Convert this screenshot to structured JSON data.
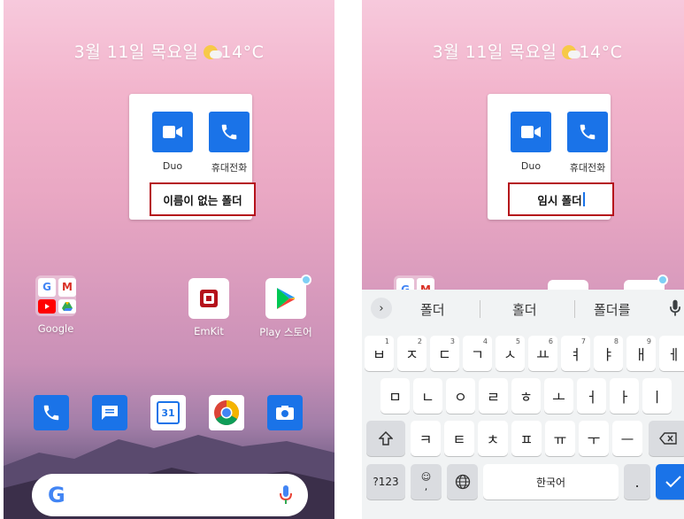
{
  "left": {
    "date_weather": "3월 11일 목요일",
    "temperature": "14°C",
    "folder": {
      "apps": [
        {
          "label": "Duo",
          "icon": "video-camera-icon"
        },
        {
          "label": "휴대전화",
          "icon": "phone-icon"
        }
      ],
      "name": "이름이 없는 폴더"
    },
    "home_apps": [
      {
        "label": "Google",
        "icon": "google-folder-icon"
      },
      {
        "label": "EmKit",
        "icon": "emkit-icon"
      },
      {
        "label": "Play 스토어",
        "icon": "play-store-icon"
      }
    ],
    "dock": [
      "phone-icon",
      "messages-icon",
      "calendar-icon",
      "chrome-icon",
      "camera-icon"
    ],
    "calendar_day": "31"
  },
  "right": {
    "date_weather": "3월 11일 목요일",
    "temperature": "14°C",
    "folder": {
      "apps": [
        {
          "label": "Duo",
          "icon": "video-camera-icon"
        },
        {
          "label": "휴대전화",
          "icon": "phone-icon"
        }
      ],
      "name": "임시 폴더"
    },
    "keyboard": {
      "suggestions": [
        "폴더",
        "홀더",
        "폴더를"
      ],
      "row1": [
        {
          "k": "ㅂ",
          "n": "1"
        },
        {
          "k": "ㅈ",
          "n": "2"
        },
        {
          "k": "ㄷ",
          "n": "3"
        },
        {
          "k": "ㄱ",
          "n": "4"
        },
        {
          "k": "ㅅ",
          "n": "5"
        },
        {
          "k": "ㅛ",
          "n": "6"
        },
        {
          "k": "ㅕ",
          "n": "7"
        },
        {
          "k": "ㅑ",
          "n": "8"
        },
        {
          "k": "ㅐ",
          "n": "9"
        },
        {
          "k": "ㅔ",
          "n": ""
        }
      ],
      "row2": [
        "ㅁ",
        "ㄴ",
        "ㅇ",
        "ㄹ",
        "ㅎ",
        "ㅗ",
        "ㅓ",
        "ㅏ",
        "ㅣ"
      ],
      "row3": [
        "ㅋ",
        "ㅌ",
        "ㅊ",
        "ㅍ",
        "ㅠ",
        "ㅜ",
        "ㅡ"
      ],
      "symbols_label": "?123",
      "space_label": "한국어",
      "period_label": "."
    }
  },
  "colors": {
    "accent": "#1a73e8",
    "highlight_border": "#b5121b"
  }
}
